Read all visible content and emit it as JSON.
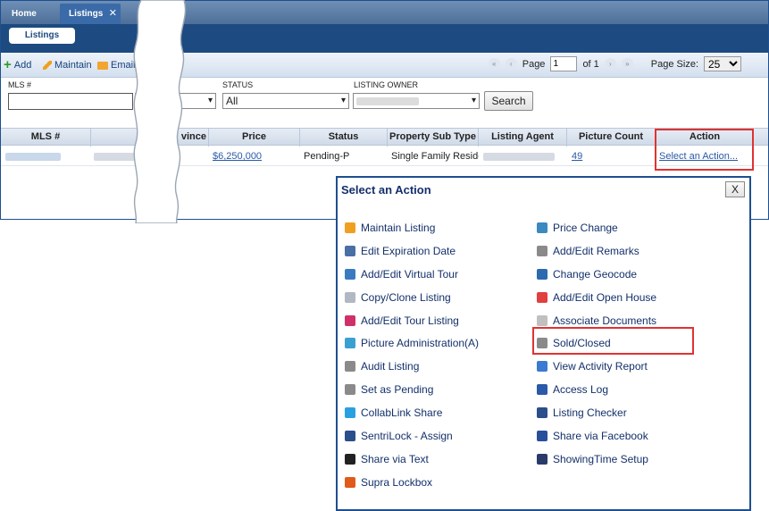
{
  "tabs": {
    "home": "Home",
    "listings": "Listings",
    "close": "✕"
  },
  "subtab": "Listings",
  "toolbar": {
    "add": "Add",
    "maintain": "Maintain",
    "email": "Email"
  },
  "pager": {
    "first": "«",
    "prev": "‹",
    "page_label": "Page",
    "page_value": "1",
    "of_label": "of 1",
    "next": "›",
    "last": "»",
    "size_label": "Page Size:",
    "size_value": "25"
  },
  "filters": {
    "mls_label": "MLS #",
    "status_label": "STATUS",
    "status_value": "All",
    "owner_label": "LISTING OWNER",
    "search": "Search"
  },
  "grid": {
    "headers": {
      "mls": "MLS #",
      "province": "vince",
      "price": "Price",
      "status": "Status",
      "subtype": "Property Sub Type",
      "agent": "Listing Agent",
      "piccount": "Picture Count",
      "action": "Action"
    },
    "row": {
      "price": "$6,250,000",
      "status": "Pending-P",
      "subtype": "Single Family Residence",
      "piccount": "49",
      "action": "Select an Action..."
    }
  },
  "popup": {
    "title": "Select an Action",
    "close": "X",
    "left_items": [
      {
        "label": "Maintain Listing",
        "icon": "pencil-icon",
        "color": "#f0a020"
      },
      {
        "label": "Edit Expiration Date",
        "icon": "printer-icon",
        "color": "#4a6fa5"
      },
      {
        "label": "Add/Edit Virtual Tour",
        "icon": "camera-icon",
        "color": "#3a7ac0"
      },
      {
        "label": "Copy/Clone Listing",
        "icon": "copy-icon",
        "color": "#b0b8c4"
      },
      {
        "label": "Add/Edit Tour Listing",
        "icon": "tour-icon",
        "color": "#d0306a"
      },
      {
        "label": "Picture Administration(A)",
        "icon": "picture-icon",
        "color": "#3aa0d0"
      },
      {
        "label": "Audit Listing",
        "icon": "notepad-icon",
        "color": "#8a8a8a"
      },
      {
        "label": "Set as Pending",
        "icon": "notepad-icon",
        "color": "#8a8a8a"
      },
      {
        "label": "CollabLink Share",
        "icon": "collablink-icon",
        "color": "#2aa0e0"
      },
      {
        "label": "SentriLock - Assign",
        "icon": "sentrilock-icon",
        "color": "#2a4f8a"
      },
      {
        "label": "Share via Text",
        "icon": "phone-icon",
        "color": "#222222"
      },
      {
        "label": "Supra Lockbox",
        "icon": "supra-icon",
        "color": "#e05a1a"
      }
    ],
    "right_items": [
      {
        "label": "Price Change",
        "icon": "price-icon",
        "color": "#3a8ac0"
      },
      {
        "label": "Add/Edit Remarks",
        "icon": "notepad-icon",
        "color": "#8a8a8a"
      },
      {
        "label": "Change Geocode",
        "icon": "globe-icon",
        "color": "#2a6ab0"
      },
      {
        "label": "Add/Edit Open House",
        "icon": "house-icon",
        "color": "#e04040"
      },
      {
        "label": "Associate Documents",
        "icon": "document-icon",
        "color": "#c0c0c0"
      },
      {
        "label": "Sold/Closed",
        "icon": "notepad-icon",
        "color": "#8a8a8a"
      },
      {
        "label": "View Activity Report",
        "icon": "chart-icon",
        "color": "#3a7ad0"
      },
      {
        "label": "Access Log",
        "icon": "log-icon",
        "color": "#2a5aa8"
      },
      {
        "label": "Listing Checker",
        "icon": "checker-icon",
        "color": "#2a4f8a"
      },
      {
        "label": "Share via Facebook",
        "icon": "facebook-icon",
        "color": "#2a4f9a"
      },
      {
        "label": "ShowingTime Setup",
        "icon": "showingtime-icon",
        "color": "#2a3a6a"
      }
    ]
  }
}
